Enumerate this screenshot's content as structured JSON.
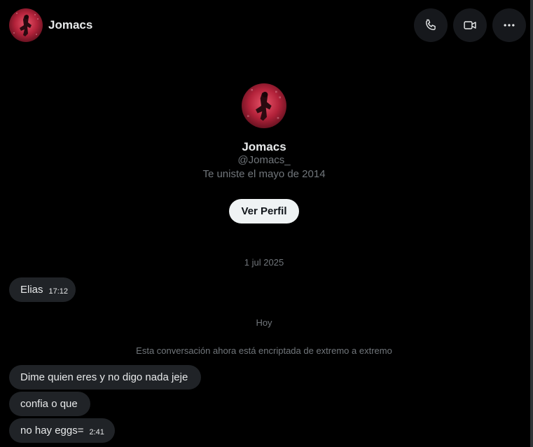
{
  "header": {
    "contact_name": "Jomacs",
    "actions": [
      {
        "name": "call",
        "icon": "phone-icon"
      },
      {
        "name": "video",
        "icon": "video-icon"
      },
      {
        "name": "more",
        "icon": "more-horizontal-icon"
      }
    ]
  },
  "profile": {
    "name": "Jomacs",
    "handle": "@Jomacs_",
    "joined": "Te uniste el mayo de 2014",
    "view_profile_label": "Ver Perfil"
  },
  "conversation": {
    "date_1": "1 jul 2025",
    "date_2": "Hoy",
    "encryption_note": "Esta conversación ahora está encriptada de extremo a extremo",
    "messages": [
      {
        "text": "Elias",
        "time": "17:12"
      },
      {
        "text": "Dime quien eres y no digo nada jeje",
        "time": ""
      },
      {
        "text": "confia o que",
        "time": ""
      },
      {
        "text": "no hay eggs=",
        "time": "2:41"
      }
    ]
  },
  "colors": {
    "background": "#000000",
    "bubble": "#202327",
    "primary_text": "#e7e9ea",
    "secondary_text": "#71767b",
    "button_light": "#eff3f4",
    "icon_button_bg": "#16181c",
    "avatar_red": "#c0283a"
  }
}
